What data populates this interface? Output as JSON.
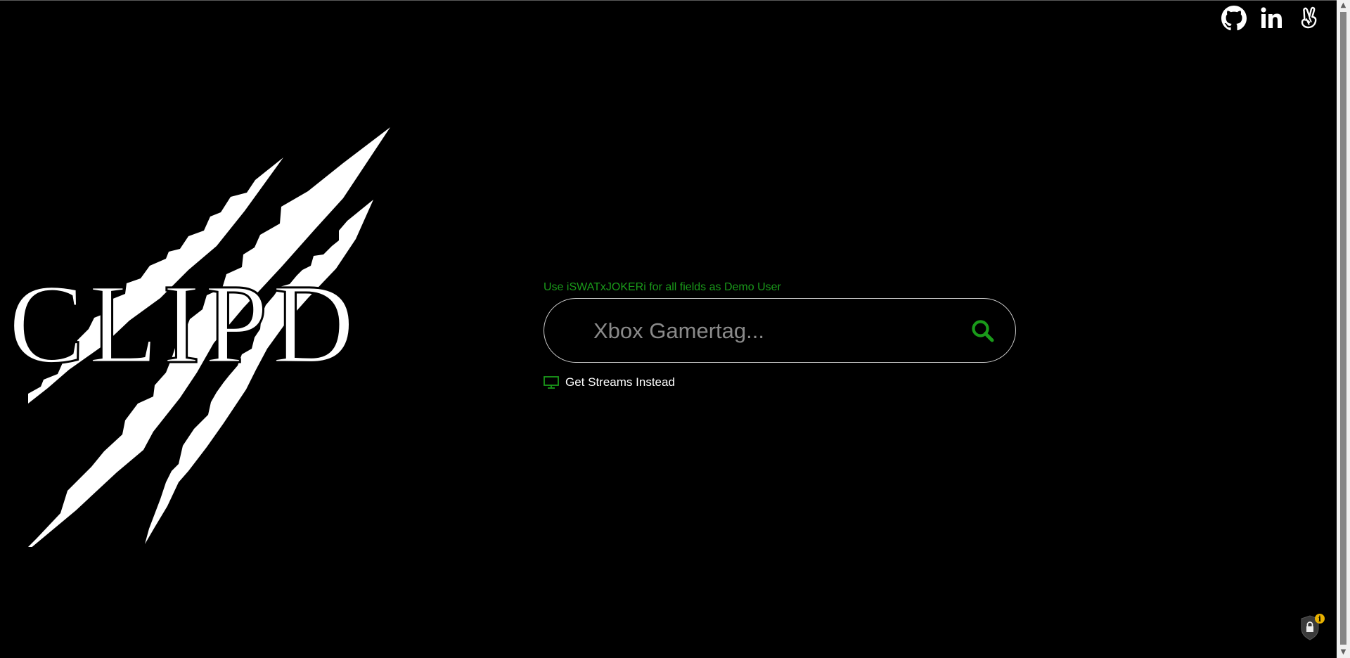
{
  "demo_hint": "Use iSWATxJOKERi for all fields as Demo User",
  "search": {
    "placeholder": "Xbox Gamertag...",
    "value": ""
  },
  "streams_toggle": {
    "label": "Get Streams Instead"
  },
  "social_links": [
    {
      "icon": "github-icon"
    },
    {
      "icon": "linkedin-icon"
    },
    {
      "icon": "angellist-icon"
    }
  ],
  "logo": {
    "text": "CLIPD"
  },
  "colors": {
    "background": "#000000",
    "accent": "#1a9a1a",
    "text": "#ffffff",
    "input_border": "#cfcfcf"
  }
}
